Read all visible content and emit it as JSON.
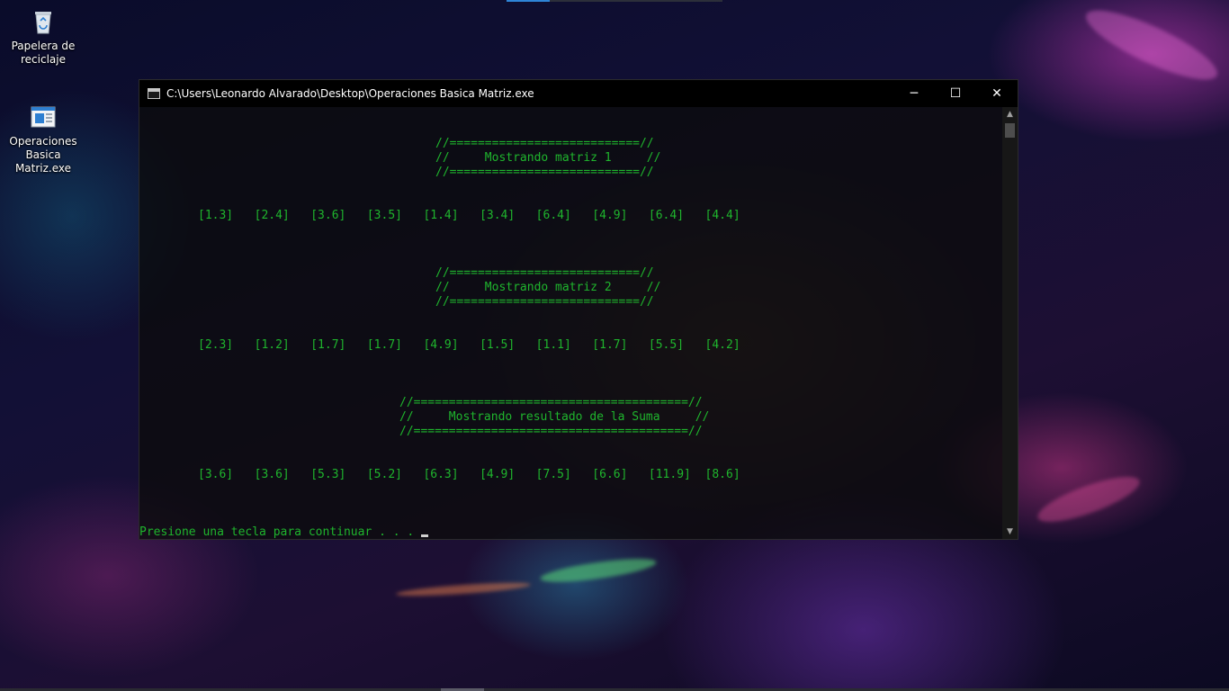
{
  "desktop": {
    "icons": [
      {
        "label": "Papelera de reciclaje",
        "icon": "recycle-bin-icon"
      },
      {
        "label": "Operaciones Basica Matriz.exe",
        "icon": "executable-icon"
      }
    ]
  },
  "window": {
    "title": "C:\\Users\\Leonardo Alvarado\\Desktop\\Operaciones Basica Matriz.exe",
    "minimize_glyph": "─",
    "maximize_glyph": "☐",
    "close_glyph": "✕"
  },
  "console": {
    "banner1_top": "//===========================//",
    "banner1_mid": "//     Mostrando matriz 1     //",
    "banner1_bot": "//===========================//",
    "matrix1": "[1.3]   [2.4]   [3.6]   [3.5]   [1.4]   [3.4]   [6.4]   [4.9]   [6.4]   [4.4]",
    "banner2_top": "//===========================//",
    "banner2_mid": "//     Mostrando matriz 2     //",
    "banner2_bot": "//===========================//",
    "matrix2": "[2.3]   [1.2]   [1.7]   [1.7]   [4.9]   [1.5]   [1.1]   [1.7]   [5.5]   [4.2]",
    "banner3_top": "//=======================================//",
    "banner3_mid": "//     Mostrando resultado de la Suma     //",
    "banner3_bot": "//=======================================//",
    "result": "[3.6]   [3.6]   [5.3]   [5.2]   [6.3]   [4.9]   [7.5]   [6.6]   [11.9]  [8.6]",
    "prompt": "Presione una tecla para continuar . . . "
  },
  "colors": {
    "console_text": "#1fb52d",
    "titlebar": "#000000"
  }
}
